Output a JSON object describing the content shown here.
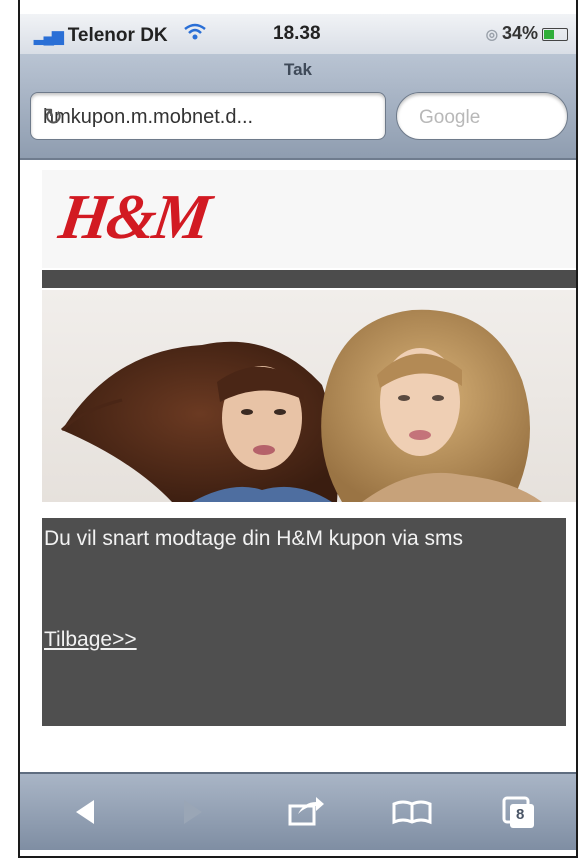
{
  "status_bar": {
    "carrier": "Telenor DK",
    "time": "18.38",
    "battery": "34%"
  },
  "browser": {
    "page_title": "Tak",
    "url": "hmkupon.m.mobnet.d...",
    "search_placeholder": "Google"
  },
  "page": {
    "logo_text": "H&M",
    "message": "Du vil snart modtage din H&M kupon via sms",
    "back_link": "Tilbage>>"
  },
  "toolbar": {
    "tabs_count": "8"
  },
  "colors": {
    "brand_red": "#d21a22",
    "panel_gray": "#4f4f4f",
    "bar_dark": "#4c4c4c"
  },
  "icons": [
    "signal-icon",
    "wifi-icon",
    "lock-icon",
    "battery-icon",
    "reload-icon",
    "back-arrow-icon",
    "forward-arrow-icon",
    "share-icon",
    "bookmarks-icon",
    "tabs-icon"
  ]
}
